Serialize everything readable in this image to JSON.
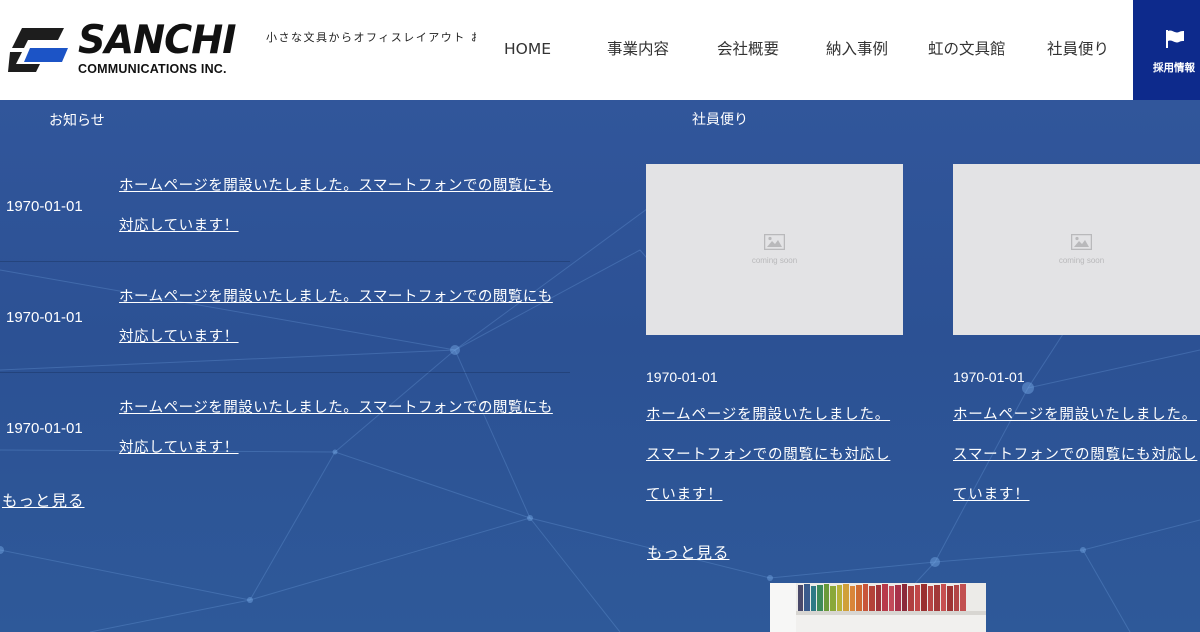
{
  "header": {
    "logo_main": "SANCHI",
    "logo_sub": "COMMUNICATIONS INC.",
    "tagline": "小さな文具からオフィスレイアウト お客様のパートナーとして常にサポ",
    "nav": [
      "HOME",
      "事業内容",
      "会社概要",
      "納入事例",
      "虹の文具館",
      "社員便り"
    ],
    "recruit": {
      "label": "採用情報",
      "icon": "flag-icon"
    }
  },
  "news": {
    "title": "お知らせ",
    "items": [
      {
        "date": "1970-01-01",
        "text": "ホームページを開設いたしました。スマートフォンでの閲覧にも対応しています！"
      },
      {
        "date": "1970-01-01",
        "text": "ホームページを開設いたしました。スマートフォンでの閲覧にも対応しています！"
      },
      {
        "date": "1970-01-01",
        "text": "ホームページを開設いたしました。スマートフォンでの閲覧にも対応しています！"
      }
    ],
    "more": "もっと見る"
  },
  "staff": {
    "title": "社員便り",
    "cards": [
      {
        "image_text": "coming soon",
        "date": "1970-01-01",
        "text": "ホームページを開設いたしました。スマートフォンでの閲覧にも対応しています！"
      },
      {
        "image_text": "coming soon",
        "date": "1970-01-01",
        "text": "ホームページを開設いたしました。スマートフォンでの閲覧にも対応しています！"
      }
    ],
    "more": "もっと見る"
  },
  "colors": {
    "background": "#2b5196",
    "recruit_bg": "#0d2a8c",
    "header_bg": "#ffffff"
  }
}
